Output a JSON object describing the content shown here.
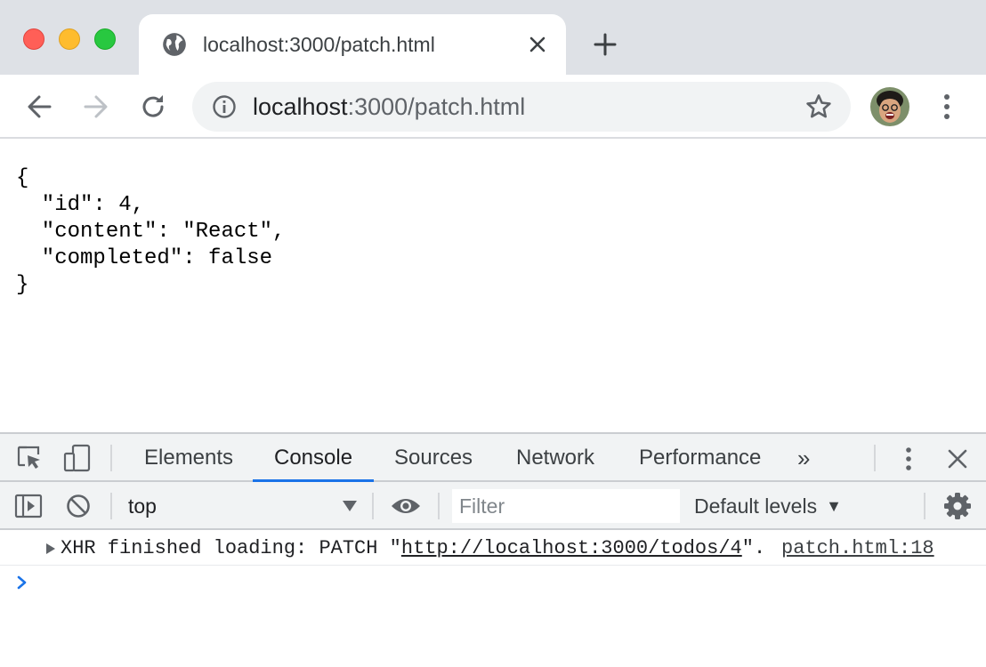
{
  "tab": {
    "title": "localhost:3000/patch.html",
    "globe_icon": "globe-icon",
    "close_icon": "close-icon"
  },
  "toolbar": {
    "url_host": "localhost",
    "url_rest": ":3000/patch.html",
    "icons": [
      "back-icon",
      "forward-icon",
      "reload-icon",
      "info-icon",
      "star-icon",
      "avatar",
      "more-vert-icon"
    ]
  },
  "page": {
    "json_text": "{\n  \"id\": 4,\n  \"content\": \"React\",\n  \"completed\": false\n}"
  },
  "devtools": {
    "tabs": [
      "Elements",
      "Console",
      "Sources",
      "Network",
      "Performance"
    ],
    "active_tab": "Console",
    "overflow": "»",
    "context": "top",
    "filter_placeholder": "Filter",
    "levels": "Default levels",
    "log": {
      "prefix": "XHR finished loading: PATCH \"",
      "link": "http://localhost:3000/todos/4",
      "suffix": "\".",
      "source": "patch.html:18"
    }
  },
  "colors": {
    "tabstrip_bg": "#dee1e6",
    "accent": "#1a73e8",
    "traffic_close": "#ff5f57",
    "traffic_min": "#febc2e",
    "traffic_max": "#28c840"
  }
}
